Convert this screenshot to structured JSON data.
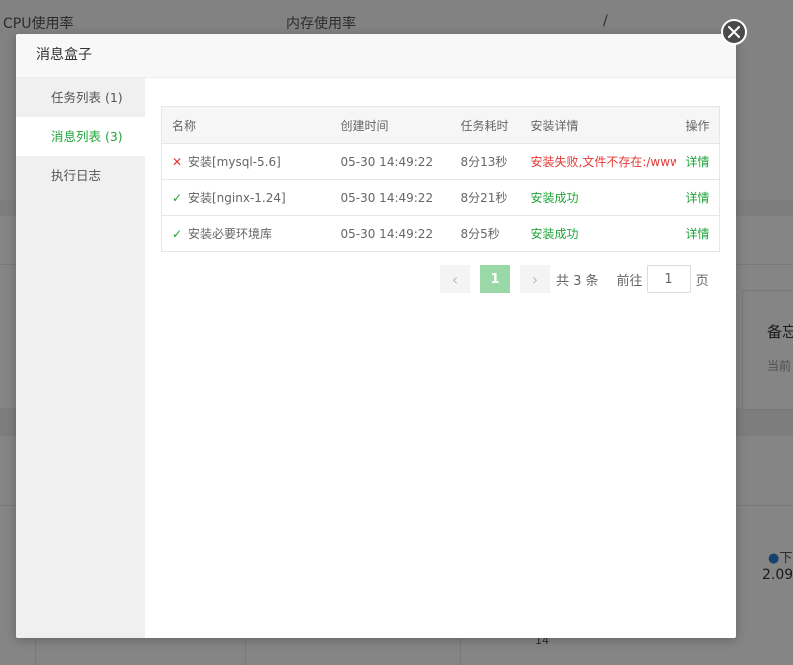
{
  "background": {
    "cpu_label": "CPU使用率",
    "mem_label": "内存使用率",
    "slash": "/",
    "backup_title": "备忘",
    "backup_sub": "当前",
    "legend_text": "下",
    "legend_value": "2.09",
    "axis_tick": "14"
  },
  "dialog": {
    "title": "消息盒子",
    "sidebar": [
      {
        "label": "任务列表 (1)"
      },
      {
        "label": "消息列表 (3)"
      },
      {
        "label": "执行日志"
      }
    ],
    "table": {
      "headers": [
        "名称",
        "创建时间",
        "任务耗时",
        "安装详情",
        "操作"
      ],
      "rows": [
        {
          "status": "fail",
          "name": "安装[mysql-5.6]",
          "time": "05-30 14:49:22",
          "duration": "8分13秒",
          "detail": "安装失败,文件不存在:/www/server/panel/install/",
          "action": "详情"
        },
        {
          "status": "ok",
          "name": "安装[nginx-1.24]",
          "time": "05-30 14:49:22",
          "duration": "8分21秒",
          "detail": "安装成功",
          "action": "详情"
        },
        {
          "status": "ok",
          "name": "安装必要环境库",
          "time": "05-30 14:49:22",
          "duration": "8分5秒",
          "detail": "安装成功",
          "action": "详情"
        }
      ]
    },
    "pager": {
      "prev": "‹",
      "page": "1",
      "next": "›",
      "total": "共 3 条",
      "goto": "前往",
      "goto_value": "1",
      "page_unit": "页"
    }
  },
  "colors": {
    "accent": "#20a53a",
    "error": "#e53935"
  }
}
